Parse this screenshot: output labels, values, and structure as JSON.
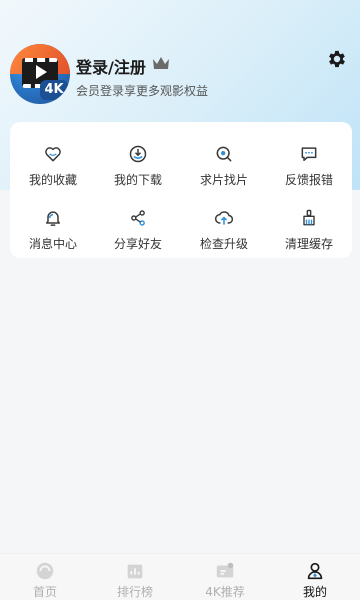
{
  "header": {
    "login_title": "登录/注册",
    "subtitle": "会员登录享更多观影权益",
    "avatar_badge": "4K"
  },
  "menu": {
    "items": [
      {
        "label": "我的收藏",
        "icon": "heart-icon"
      },
      {
        "label": "我的下载",
        "icon": "download-icon"
      },
      {
        "label": "求片找片",
        "icon": "search-film-icon"
      },
      {
        "label": "反馈报错",
        "icon": "feedback-icon"
      },
      {
        "label": "消息中心",
        "icon": "bell-icon"
      },
      {
        "label": "分享好友",
        "icon": "share-icon"
      },
      {
        "label": "检查升级",
        "icon": "upgrade-icon"
      },
      {
        "label": "清理缓存",
        "icon": "broom-icon"
      }
    ]
  },
  "bottom_nav": {
    "tabs": [
      {
        "label": "首页",
        "icon": "home-icon",
        "active": false
      },
      {
        "label": "排行榜",
        "icon": "ranking-icon",
        "active": false
      },
      {
        "label": "4K推荐",
        "icon": "recommend-icon",
        "active": false
      },
      {
        "label": "我的",
        "icon": "profile-icon",
        "active": true
      }
    ]
  },
  "colors": {
    "accent": "#2f8fd8",
    "icon_stroke": "#3a3a3a",
    "inactive_tab": "#b0b0b0",
    "active_tab": "#111111"
  }
}
